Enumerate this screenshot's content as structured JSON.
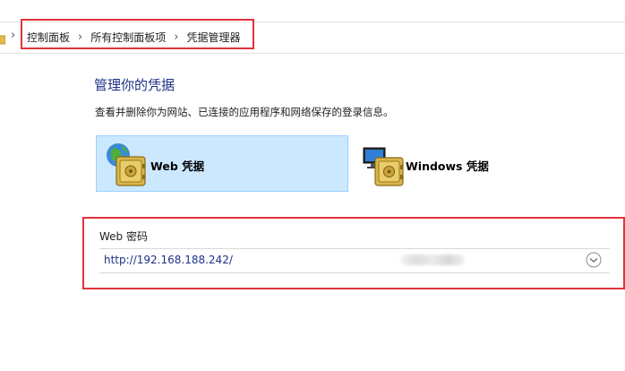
{
  "breadcrumb": {
    "items": [
      "控制面板",
      "所有控制面板项",
      "凭据管理器"
    ]
  },
  "page": {
    "title": "管理你的凭据",
    "description": "查看并删除你为网站、已连接的应用程序和网络保存的登录信息。"
  },
  "credential_types": {
    "web_label": "Web 凭据",
    "windows_label": "Windows 凭据"
  },
  "web_passwords": {
    "section_title": "Web 密码",
    "entries": [
      {
        "url": "http://192.168.188.242/"
      }
    ]
  },
  "colors": {
    "highlight": "#e0343c",
    "selected_tile": "#cce8ff",
    "link": "#1e3287"
  }
}
